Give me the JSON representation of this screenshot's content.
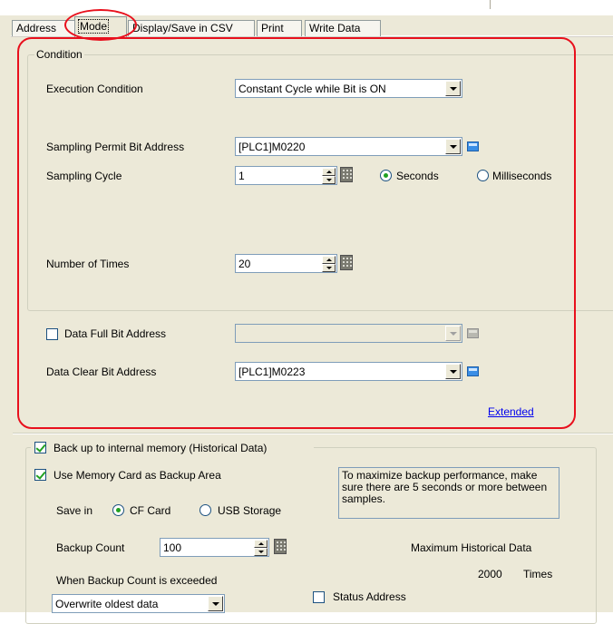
{
  "tabs": [
    {
      "label": "Address"
    },
    {
      "label": "Mode"
    },
    {
      "label": "Display/Save in CSV"
    },
    {
      "label": "Print"
    },
    {
      "label": "Write Data"
    }
  ],
  "condition": {
    "legend": "Condition",
    "execution_condition": {
      "label": "Execution Condition",
      "value": "Constant Cycle while Bit is ON"
    },
    "sampling_permit": {
      "label": "Sampling Permit Bit Address",
      "value": "[PLC1]M0220"
    },
    "sampling_cycle": {
      "label": "Sampling Cycle",
      "value": "1",
      "unit_seconds": "Seconds",
      "unit_ms": "Milliseconds",
      "selected_unit": "Seconds"
    },
    "number_of_times": {
      "label": "Number of Times",
      "value": "20"
    }
  },
  "data_full": {
    "label": "Data Full Bit Address",
    "checked": false,
    "value": ""
  },
  "data_clear": {
    "label": "Data Clear Bit Address",
    "value": "[PLC1]M0223"
  },
  "extended_link": "Extended",
  "backup": {
    "legend_label": "Back up to internal memory (Historical Data)",
    "legend_checked": true,
    "memory_card_label": "Use Memory Card as Backup Area",
    "memory_card_checked": true,
    "save_in_label": "Save in",
    "cf_card_label": "CF Card",
    "usb_label": "USB Storage",
    "selected_storage": "CF Card",
    "note": "To maximize backup performance, make sure there are 5 seconds or more between samples.",
    "backup_count_label": "Backup Count",
    "backup_count_value": "100",
    "max_hist_label": "Maximum Historical Data",
    "max_hist_value": "2000",
    "max_hist_unit": "Times",
    "exceeded_label": "When Backup Count is exceeded",
    "exceeded_value": "Overwrite oldest data",
    "status_address_label": "Status Address",
    "status_address_checked": false
  },
  "colors": {
    "highlight": "#e8101d",
    "link": "#0000ee",
    "dialog_bg": "#ece9d8"
  }
}
